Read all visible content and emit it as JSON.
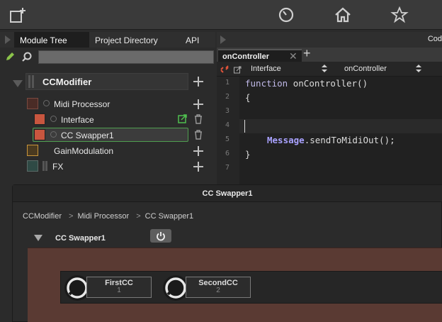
{
  "tree_tabs": [
    "Module Tree",
    "Project Directory",
    "API"
  ],
  "search": {
    "value": ""
  },
  "tree": {
    "root": "CCModifier",
    "items": [
      {
        "label": "Midi Processor",
        "color": "#4a2c26"
      },
      {
        "label": "Interface",
        "color": "#c8563f"
      },
      {
        "label": "CC Swapper1",
        "color": "#c8563f"
      },
      {
        "label": "GainModulation",
        "color": "#c9953a"
      },
      {
        "label": "FX",
        "color": "#2f4a45"
      }
    ]
  },
  "editor": {
    "header_label": "Cod",
    "tab_label": "onController",
    "selector_left": "Interface",
    "selector_right": "onController",
    "lines": [
      "1",
      "2",
      "3",
      "4",
      "5",
      "6",
      "7"
    ],
    "code": {
      "l1_kw": "function",
      "l1_rest": " onController()",
      "l2": "{",
      "l5_cls": "Message",
      "l5_rest": ".sendToMidiOut();",
      "l6": "}"
    }
  },
  "panel": {
    "title": "CC Swapper1",
    "breadcrumb": [
      "CCModifier",
      "Midi Processor",
      "CC Swapper1"
    ],
    "module_name": "CC Swapper1",
    "knobs": [
      {
        "name": "FirstCC",
        "value": "1"
      },
      {
        "name": "SecondCC",
        "value": "2"
      }
    ]
  },
  "colors": {
    "accent_green": "#4f9e4f",
    "interface_bg": "#5a3a33"
  }
}
